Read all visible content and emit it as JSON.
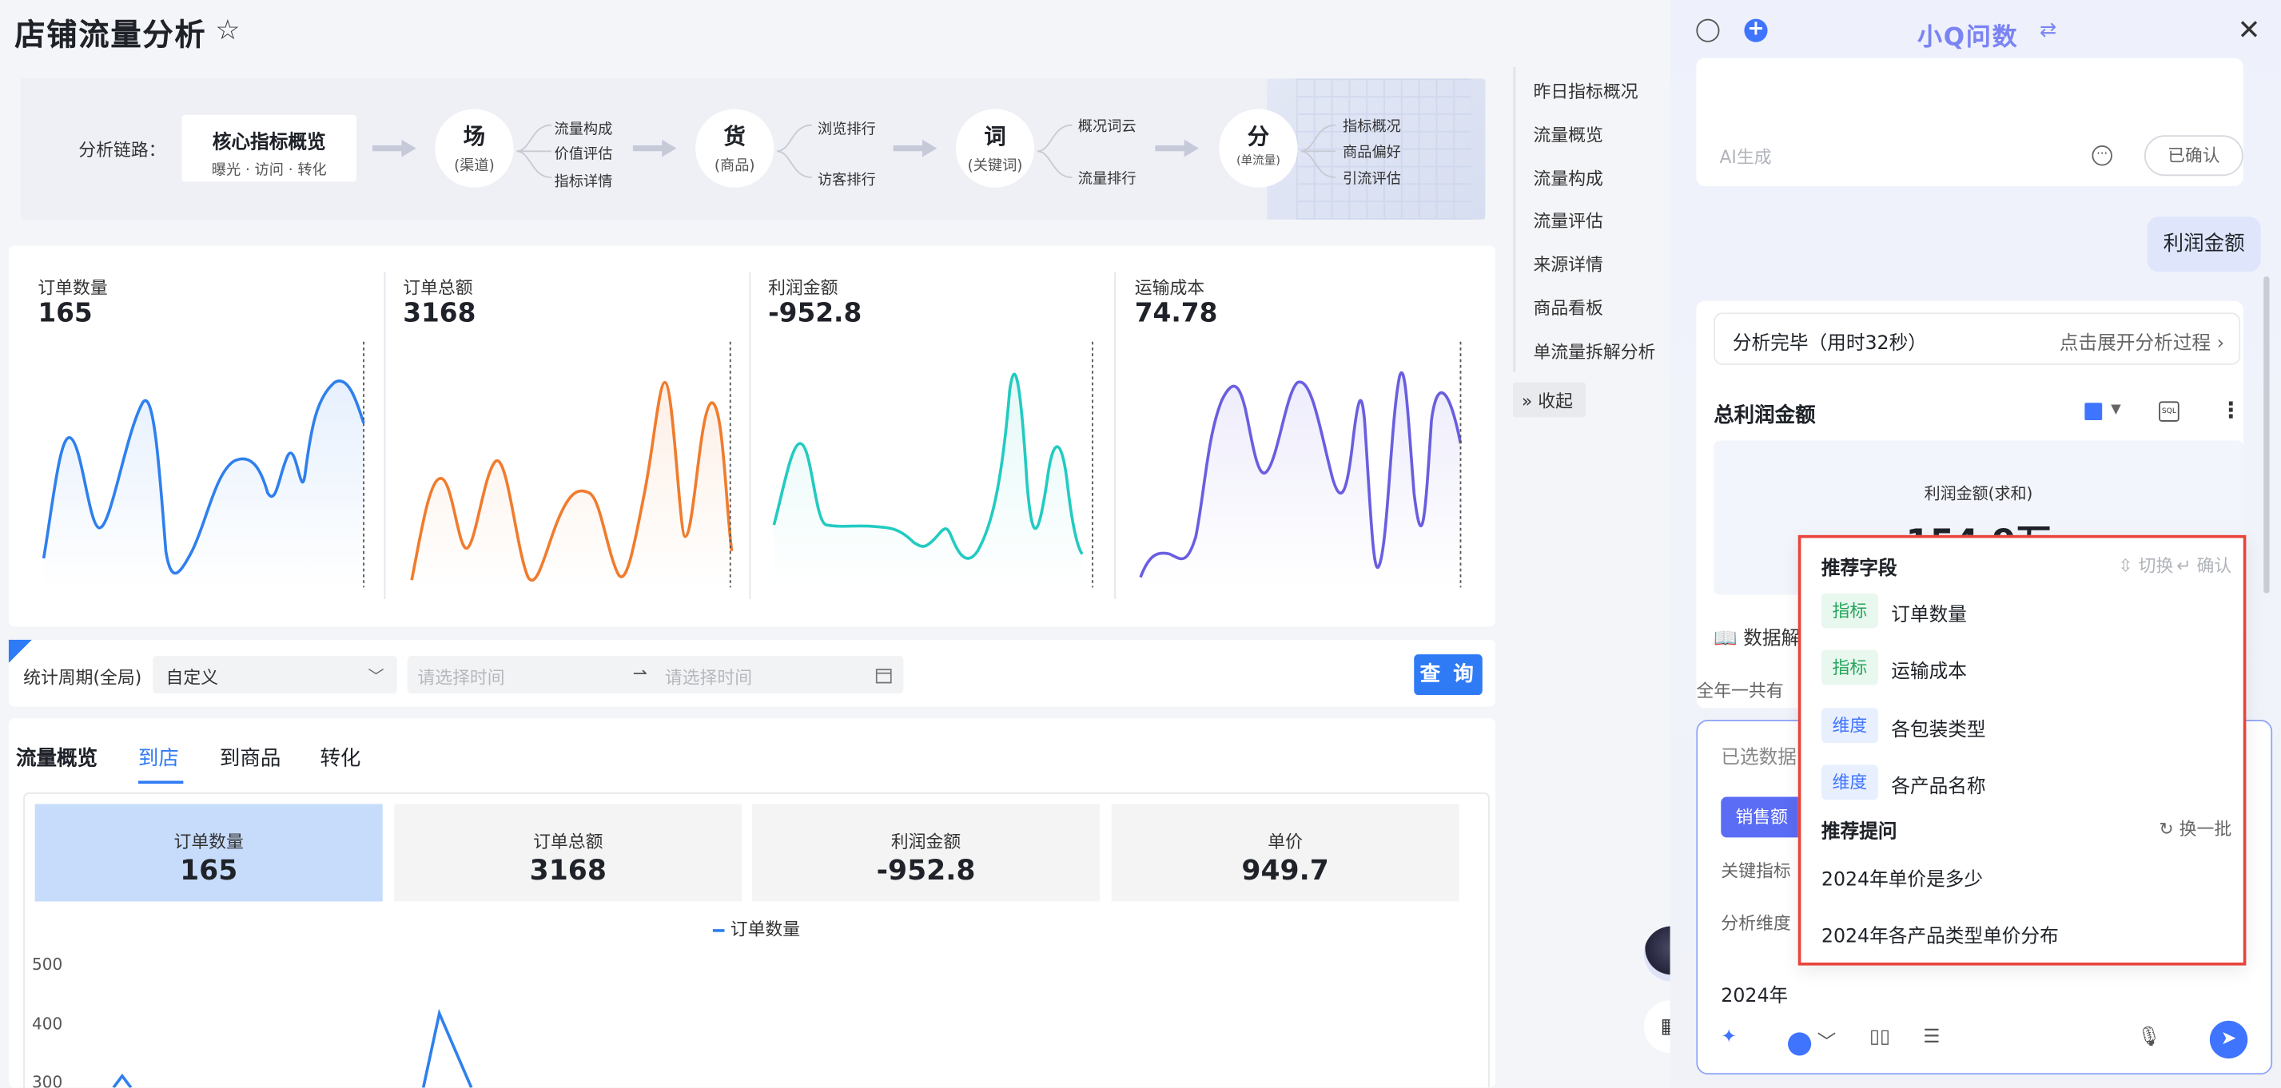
{
  "page": {
    "title": "店铺流量分析"
  },
  "chain": {
    "label": "分析链路：",
    "core_title": "核心指标概览",
    "core_sub": "曝光 · 访问 · 转化",
    "nodes": [
      {
        "title": "场",
        "sub": "(渠道)",
        "items": [
          "流量构成",
          "价值评估",
          "指标详情"
        ]
      },
      {
        "title": "货",
        "sub": "(商品)",
        "items": [
          "浏览排行",
          "访客排行"
        ]
      },
      {
        "title": "词",
        "sub": "(关键词)",
        "items": [
          "概况词云",
          "流量排行"
        ]
      },
      {
        "title": "分",
        "sub": "(单流量)",
        "items": [
          "指标概况",
          "商品偏好",
          "引流评估"
        ]
      }
    ]
  },
  "kpis": [
    {
      "label": "订单数量",
      "value": "165",
      "color": "#2f80ed"
    },
    {
      "label": "订单总额",
      "value": "3168",
      "color": "#f07c2e"
    },
    {
      "label": "利润金额",
      "value": "-952.8",
      "color": "#22cbc1"
    },
    {
      "label": "运输成本",
      "value": "74.78",
      "color": "#6a5ee0"
    }
  ],
  "filter": {
    "period_label": "统计周期(全局)",
    "period_value": "自定义",
    "start_placeholder": "请选择时间",
    "end_placeholder": "请选择时间",
    "query_label": "查 询"
  },
  "tabs": {
    "items": [
      "流量概览",
      "到店",
      "到商品",
      "转化"
    ],
    "active": 1
  },
  "metrics": [
    {
      "label": "订单数量",
      "value": "165"
    },
    {
      "label": "订单总额",
      "value": "3168"
    },
    {
      "label": "利润金额",
      "value": "-952.8"
    },
    {
      "label": "单价",
      "value": "949.7"
    }
  ],
  "bottom_chart": {
    "legend": "订单数量",
    "yticks": [
      "500",
      "400",
      "300"
    ]
  },
  "sidenav": {
    "items": [
      "昨日指标概况",
      "流量概览",
      "流量构成",
      "流量评估",
      "来源详情",
      "商品看板",
      "单流量拆解分析"
    ],
    "collapse": "收起"
  },
  "assistant": {
    "title": "小Q问数",
    "ai_label": "AI生成",
    "confirmed": "已确认",
    "user_msg": "利润金额",
    "analysis_done": "分析完毕（用时32秒）",
    "expand": "点击展开分析过程",
    "result_title": "总利润金额",
    "sql": "SQL",
    "result_label": "利润金额(求和)",
    "result_value": "154.9万",
    "data_src": "数据解",
    "whole_year": "全年一共有",
    "selected_data": "已选数据",
    "sales_chip": "销售额",
    "key_metric": "关键指标",
    "analysis_dim": "分析维度",
    "question": "2024年"
  },
  "popup": {
    "fields_title": "推荐字段",
    "switch": "切换",
    "confirm": "确认",
    "fields": [
      {
        "tag": "指标",
        "name": "订单数量"
      },
      {
        "tag": "指标",
        "name": "运输成本"
      },
      {
        "tag": "维度",
        "name": "各包装类型"
      },
      {
        "tag": "维度",
        "name": "各产品名称"
      }
    ],
    "questions_title": "推荐提问",
    "refresh": "换一批",
    "questions": [
      "2024年单价是多少",
      "2024年各产品类型单价分布"
    ]
  }
}
